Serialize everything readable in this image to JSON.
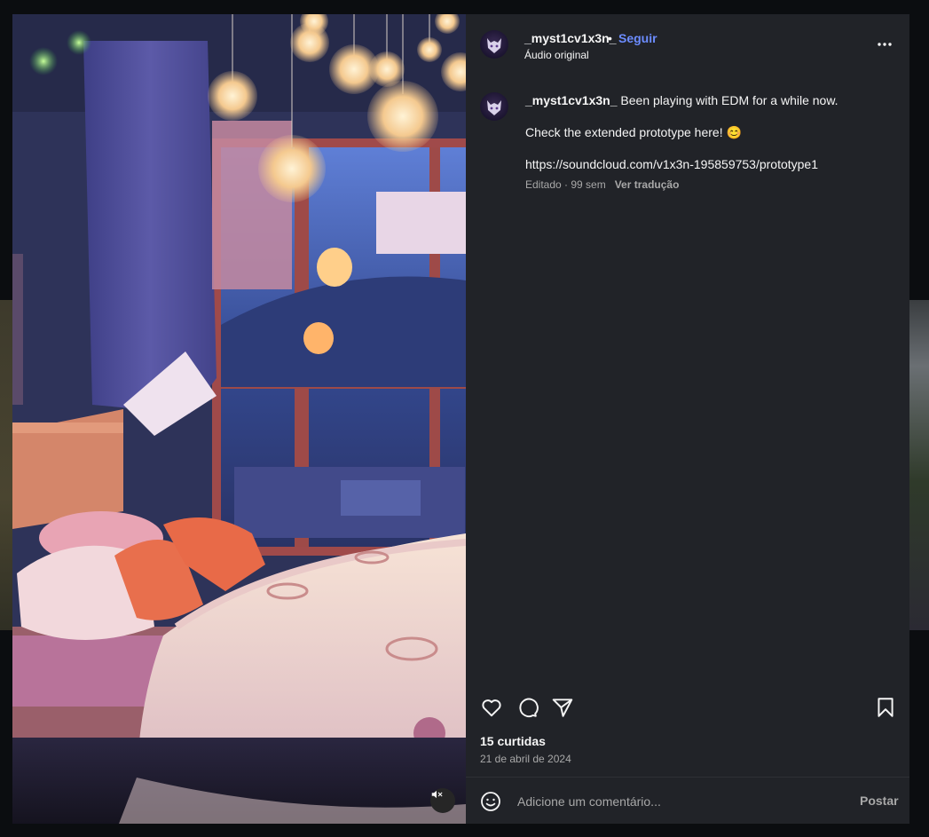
{
  "post": {
    "username": "_myst1cv1x3n_",
    "separator": "•",
    "follow_label": "Seguir",
    "audio_label": "Áudio original",
    "caption": {
      "username": "_myst1cv1x3n_",
      "line1": "Been playing with EDM for a while now.",
      "line2": "Check the extended prototype here! 😊",
      "link": "https://soundcloud.com/v1x3n-195859753/prototype1",
      "edited": "Editado · 99 sem",
      "translate_label": "Ver tradução"
    },
    "likes": "15 curtidas",
    "date": "21 de abril de 2024",
    "comment": {
      "placeholder": "Adicione um comentário...",
      "value": "",
      "post_label": "Postar"
    }
  },
  "icons": {
    "more": "more-horizontal-icon",
    "like": "heart-icon",
    "comment": "comment-icon",
    "share": "send-icon",
    "save": "bookmark-icon",
    "emoji": "emoji-icon",
    "mute": "volume-muted-icon"
  },
  "colors": {
    "modal_bg": "#212328",
    "follow_accent": "#6c8cff",
    "page_bg": "#0b0d10"
  }
}
